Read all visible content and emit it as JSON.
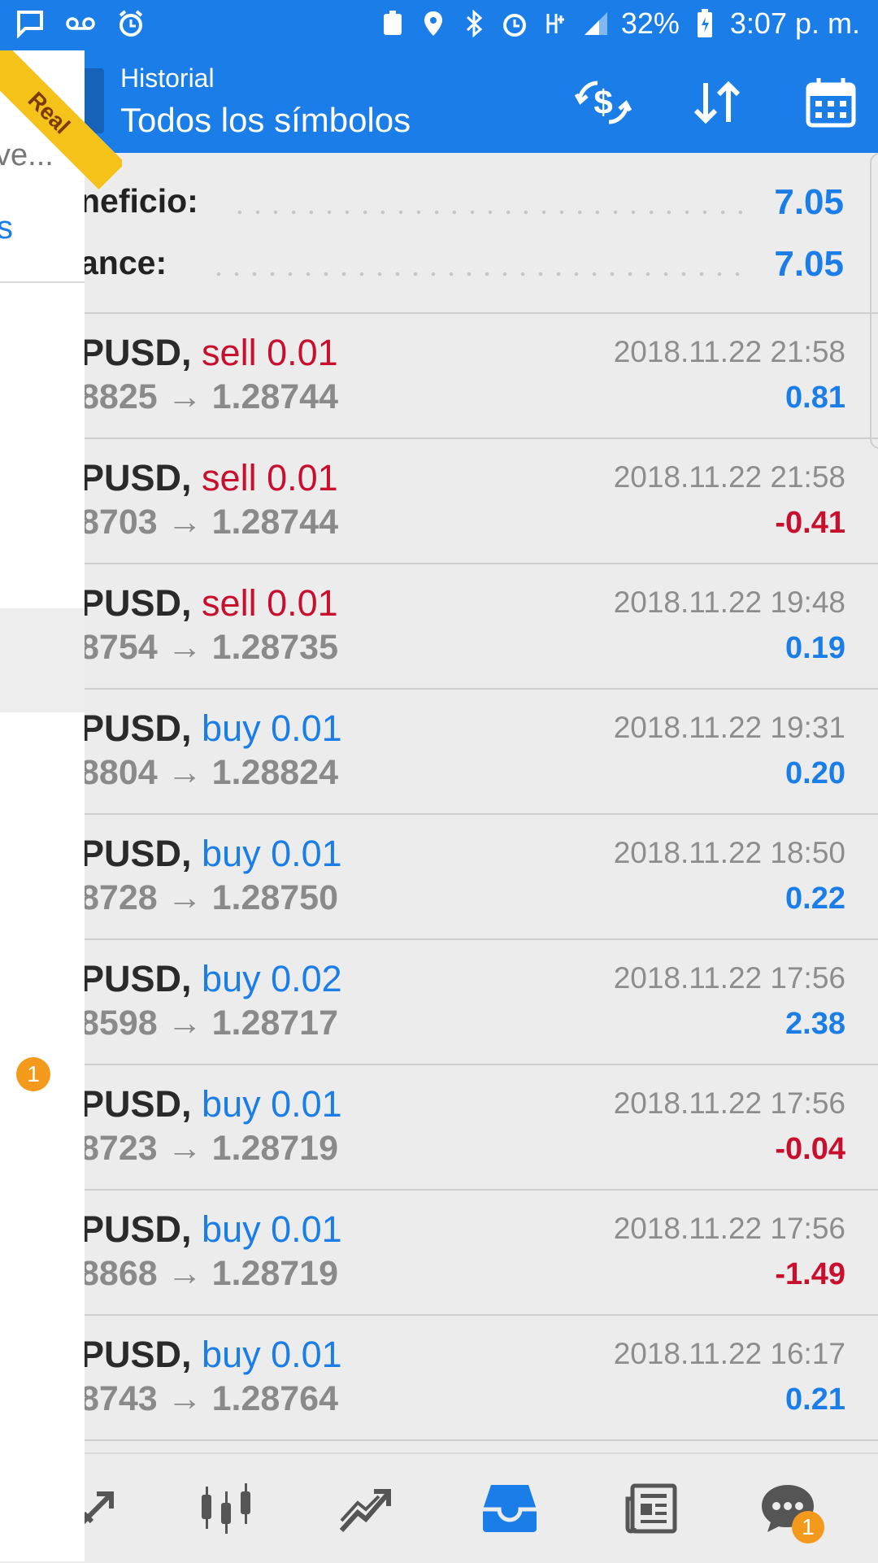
{
  "status_bar": {
    "battery_percent": "32%",
    "time": "3:07 p. m."
  },
  "drawer": {
    "item_truncated": "ve...",
    "link_fragment": "s",
    "ribbon": "Real",
    "badge_count": "1"
  },
  "app_bar": {
    "title": "Historial",
    "subtitle": "Todos los símbolos",
    "icons": [
      "currency-exchange-icon",
      "sort-icon",
      "calendar-icon"
    ]
  },
  "summary": {
    "profit_label": "neficio:",
    "profit_value": "7.05",
    "balance_label": "ance:",
    "balance_value": "7.05"
  },
  "trades": [
    {
      "symbol": "PUSD,",
      "side": "sell",
      "volume": "sell 0.01",
      "open": "8825",
      "close": "1.28744",
      "time": "2018.11.22 21:58",
      "profit": "0.81"
    },
    {
      "symbol": "PUSD,",
      "side": "sell",
      "volume": "sell 0.01",
      "open": "8703",
      "close": "1.28744",
      "time": "2018.11.22 21:58",
      "profit": "-0.41"
    },
    {
      "symbol": "PUSD,",
      "side": "sell",
      "volume": "sell 0.01",
      "open": "8754",
      "close": "1.28735",
      "time": "2018.11.22 19:48",
      "profit": "0.19"
    },
    {
      "symbol": "PUSD,",
      "side": "buy",
      "volume": "buy 0.01",
      "open": "8804",
      "close": "1.28824",
      "time": "2018.11.22 19:31",
      "profit": "0.20"
    },
    {
      "symbol": "PUSD,",
      "side": "buy",
      "volume": "buy 0.01",
      "open": "8728",
      "close": "1.28750",
      "time": "2018.11.22 18:50",
      "profit": "0.22"
    },
    {
      "symbol": "PUSD,",
      "side": "buy",
      "volume": "buy 0.02",
      "open": "8598",
      "close": "1.28717",
      "time": "2018.11.22 17:56",
      "profit": "2.38"
    },
    {
      "symbol": "PUSD,",
      "side": "buy",
      "volume": "buy 0.01",
      "open": "8723",
      "close": "1.28719",
      "time": "2018.11.22 17:56",
      "profit": "-0.04"
    },
    {
      "symbol": "PUSD,",
      "side": "buy",
      "volume": "buy 0.01",
      "open": "8868",
      "close": "1.28719",
      "time": "2018.11.22 17:56",
      "profit": "-1.49"
    },
    {
      "symbol": "PUSD,",
      "side": "buy",
      "volume": "buy 0.01",
      "open": "8743",
      "close": "1.28764",
      "time": "2018.11.22 16:17",
      "profit": "0.21"
    }
  ],
  "bottom_nav": {
    "items": [
      "quotes-icon",
      "chart-icon",
      "trade-icon",
      "history-icon",
      "news-icon",
      "chat-icon"
    ],
    "active": "history-icon",
    "chat_badge": "1"
  },
  "colors": {
    "accent": "#1b7ee8",
    "sell": "#c8102e",
    "badge": "#f39a1c",
    "ribbon": "#f5c21a"
  }
}
